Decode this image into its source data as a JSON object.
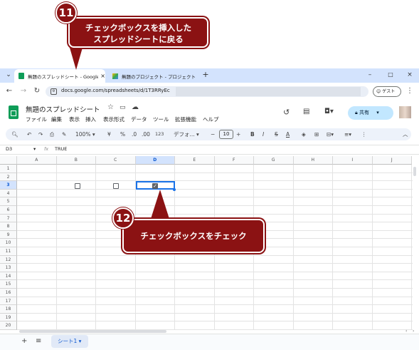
{
  "callouts": {
    "step11": {
      "number": "11",
      "line1": "チェックボックスを挿入した",
      "line2": "スプレッドシートに戻る"
    },
    "step12": {
      "number": "12",
      "text": "チェックボックスをチェック"
    }
  },
  "browser": {
    "tabs": [
      {
        "title": "無題のスプレッドシート - Google ス",
        "close": "×"
      },
      {
        "title": "無題のプロジェクト - プロジェクト編"
      }
    ],
    "new_tab": "+",
    "window_controls": {
      "minimize": "–",
      "maximize": "□",
      "close": "×"
    },
    "address": "docs.google.com/spreadsheets/d/1T3RRyEc",
    "guest_label": "ゲスト"
  },
  "app": {
    "doc_title": "無題のスプレッドシート",
    "menu": [
      "ファイル",
      "編集",
      "表示",
      "挿入",
      "表示形式",
      "データ",
      "ツール",
      "拡張機能",
      "ヘルプ"
    ],
    "share_label": "共有",
    "toolbar": {
      "zoom": "100%",
      "currency": "¥",
      "percent": "%",
      "dec_decrease": ".0",
      "dec_increase": ".00",
      "number_format": "123",
      "font": "デフォ...",
      "font_size": "10",
      "bold": "B",
      "italic": "I",
      "strike": "S",
      "text_color": "A"
    },
    "name_box": "D3",
    "fx": "fx",
    "formula_value": "TRUE"
  },
  "grid": {
    "columns": [
      "A",
      "B",
      "C",
      "D",
      "E",
      "F",
      "G",
      "H",
      "I",
      "J"
    ],
    "rows": [
      "1",
      "2",
      "3",
      "4",
      "5",
      "6",
      "7",
      "8",
      "9",
      "10",
      "11",
      "12",
      "13",
      "14",
      "15",
      "16",
      "17",
      "18",
      "19",
      "20"
    ],
    "selected_cell": "D3",
    "checkboxes": [
      {
        "cell": "B3",
        "checked": false
      },
      {
        "cell": "C3",
        "checked": false
      },
      {
        "cell": "D3",
        "checked": true
      }
    ]
  },
  "sheets": {
    "add": "+",
    "all": "≡",
    "active_sheet": "シート1"
  }
}
